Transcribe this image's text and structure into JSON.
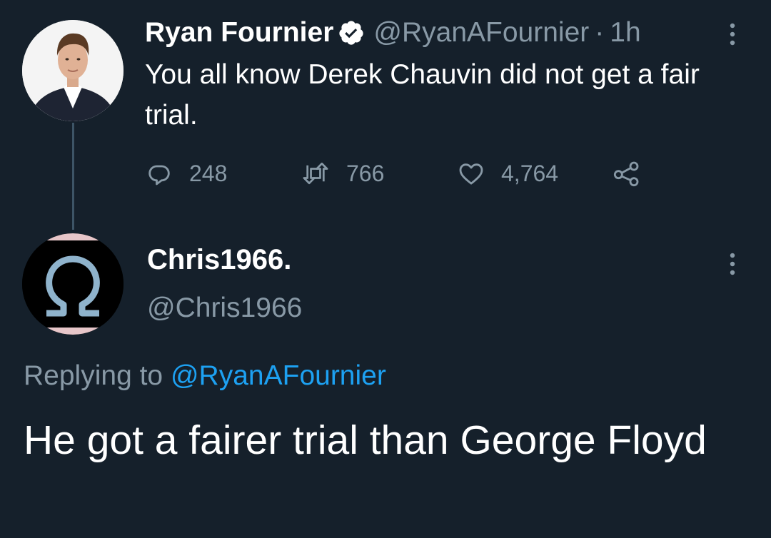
{
  "original_tweet": {
    "author_name": "Ryan Fournier",
    "verified_icon": "verified-badge-icon",
    "handle": "@RyanAFournier",
    "separator": "·",
    "time": "1h",
    "text": "You all know Derek Chauvin did not get a fair trial.",
    "actions": {
      "reply_count": "248",
      "retweet_count": "766",
      "like_count": "4,764"
    }
  },
  "reply_tweet": {
    "author_name": "Chris1966.",
    "handle": "@Chris1966",
    "replying_prefix": "Replying to",
    "replying_to": "@RyanAFournier",
    "text": "He got a fairer trial than George Floyd"
  },
  "colors": {
    "background": "#15202b",
    "primary_text": "#ffffff",
    "secondary_text": "#8899a6",
    "accent": "#1da1f2",
    "thread_line": "#3d5466"
  }
}
